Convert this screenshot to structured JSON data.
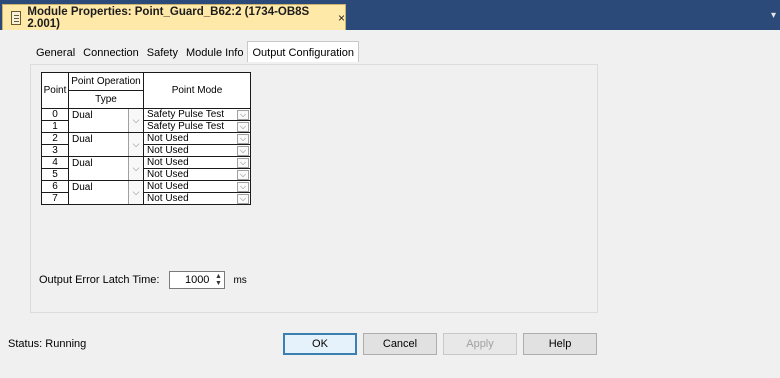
{
  "window": {
    "title": "Module Properties: Point_Guard_B62:2 (1734-OB8S 2.001)",
    "close": "×",
    "menu_arrow": "▾"
  },
  "tabs": [
    "General",
    "Connection",
    "Safety",
    "Module Info",
    "Output Configuration"
  ],
  "selected_tab": "Output Configuration",
  "table": {
    "headers": {
      "point": "Point",
      "operation": "Point Operation",
      "type": "Type",
      "mode": "Point Mode"
    },
    "groups": [
      {
        "op": "Dual",
        "rows": [
          {
            "point": "0",
            "mode": "Safety Pulse Test"
          },
          {
            "point": "1",
            "mode": "Safety Pulse Test"
          }
        ]
      },
      {
        "op": "Dual",
        "rows": [
          {
            "point": "2",
            "mode": "Not Used"
          },
          {
            "point": "3",
            "mode": "Not Used"
          }
        ]
      },
      {
        "op": "Dual",
        "rows": [
          {
            "point": "4",
            "mode": "Not Used"
          },
          {
            "point": "5",
            "mode": "Not Used"
          }
        ]
      },
      {
        "op": "Dual",
        "rows": [
          {
            "point": "6",
            "mode": "Not Used"
          },
          {
            "point": "7",
            "mode": "Not Used"
          }
        ]
      }
    ],
    "dropdown_glyph": "⌵"
  },
  "latch": {
    "label": "Output Error Latch Time:",
    "value": "1000",
    "unit": "ms",
    "up": "▲",
    "down": "▼"
  },
  "status": {
    "text": "Status:  Running"
  },
  "buttons": {
    "ok": "OK",
    "cancel": "Cancel",
    "apply": "Apply",
    "help": "Help"
  },
  "colors": {
    "titlebar": "#2b4a7a",
    "active_tab": "#ffe9a8",
    "panel": "#f0f0f0",
    "default_button_border": "#3c7fb1"
  }
}
